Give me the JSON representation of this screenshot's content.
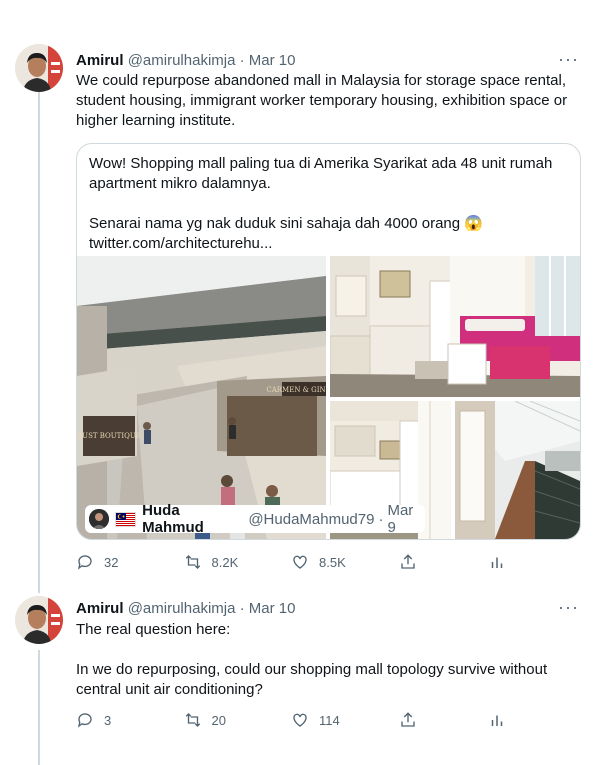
{
  "tweets": [
    {
      "name": "Amirul",
      "handle": "@amirulhakimja",
      "dot": "·",
      "date": "Mar 10",
      "more": "···",
      "text": "We could repurpose abandoned mall in Malaysia for storage space rental, student housing, immigrant worker temporary housing, exhibition space or higher learning institute.",
      "quote": {
        "text": "Wow! Shopping mall paling tua di Amerika Syarikat ada 48 unit rumah apartment mikro dalamnya.\n\nSenarai nama yg nak duduk sini sahaja dah 4000 orang 😱\ntwitter.com/architecturehu...",
        "media_sign_1": "CARMEN & GINGER",
        "media_sign_2": "AUST BOUTIQUE",
        "author_name": "Huda Mahmud",
        "author_handle": "@HudaMahmud79",
        "dot": "·",
        "author_date": "Mar 9"
      },
      "stats": {
        "replies": "32",
        "retweets": "8.2K",
        "likes": "8.5K"
      }
    },
    {
      "name": "Amirul",
      "handle": "@amirulhakimja",
      "dot": "·",
      "date": "Mar 10",
      "more": "···",
      "text": "The real question here:\n\nIn we do repurposing, could our shopping mall topology survive without central unit air conditioning?",
      "stats": {
        "replies": "3",
        "retweets": "20",
        "likes": "114"
      }
    }
  ],
  "icons": [
    "reply-icon",
    "retweet-icon",
    "like-icon",
    "share-icon",
    "analytics-icon",
    "more-icon"
  ],
  "colors": {
    "text": "#0f1419",
    "muted": "#536471",
    "border": "#cfd9de",
    "thread": "#cfd9de"
  }
}
